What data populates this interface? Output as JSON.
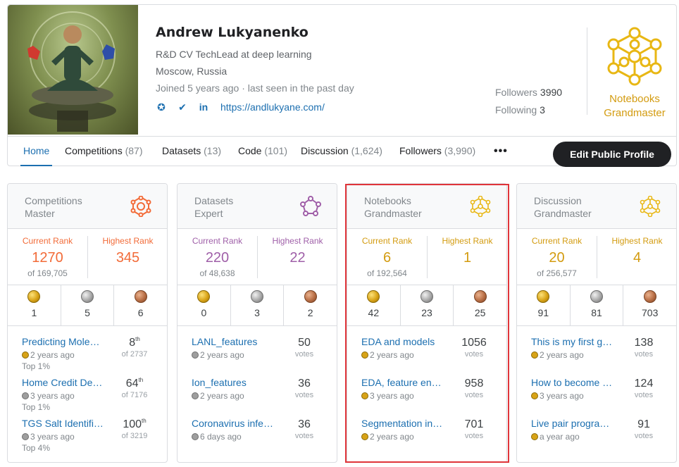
{
  "profile": {
    "name": "Andrew Lukyanenko",
    "occupation": "R&D CV TechLead at deep learning",
    "location": "Moscow, Russia",
    "joined": "Joined 5 years ago · last seen in the past day",
    "website": "https://andlukyane.com/",
    "social_icons": [
      "github-icon",
      "twitter-icon",
      "linkedin-icon"
    ],
    "social_glyphs": [
      "✪",
      "✔",
      "in"
    ],
    "followers_label": "Followers",
    "followers": "3990",
    "following_label": "Following",
    "following": "3",
    "tier": "Notebooks\nGrandmaster",
    "tier_line1": "Notebooks",
    "tier_line2": "Grandmaster"
  },
  "tabs": [
    {
      "label": "Home",
      "count": ""
    },
    {
      "label": "Competitions",
      "count": "(87)"
    },
    {
      "label": "Datasets",
      "count": "(13)"
    },
    {
      "label": "Code",
      "count": "(101)"
    },
    {
      "label": "Discussion",
      "count": "(1,624)"
    },
    {
      "label": "Followers",
      "count": "(3,990)"
    }
  ],
  "more_label": "•••",
  "edit_button": "Edit Public Profile",
  "colors": {
    "competitions": "#f26b38",
    "datasets": "#9f5fa8",
    "gold": "#d39b0f",
    "link": "#1c6fb0",
    "highlight": "#e0353a"
  },
  "cards": [
    {
      "title_line1": "Competitions",
      "title_line2": "Master",
      "current_rank_label": "Current Rank",
      "highest_rank_label": "Highest Rank",
      "current_rank": "1270",
      "of_total": "of 169,705",
      "highest_rank": "345",
      "medals": {
        "gold": "1",
        "silver": "5",
        "bronze": "6"
      },
      "items": [
        {
          "title": "Predicting Mole…",
          "medal": "gold",
          "age": "2 years ago",
          "sub": "Top 1%",
          "rank": "8",
          "suffix": "th",
          "unit": "of 2737"
        },
        {
          "title": "Home Credit De…",
          "medal": "silver",
          "age": "3 years ago",
          "sub": "Top 1%",
          "rank": "64",
          "suffix": "th",
          "unit": "of 7176"
        },
        {
          "title": "TGS Salt Identifi…",
          "medal": "silver",
          "age": "3 years ago",
          "sub": "Top 4%",
          "rank": "100",
          "suffix": "th",
          "unit": "of 3219"
        }
      ]
    },
    {
      "title_line1": "Datasets",
      "title_line2": "Expert",
      "current_rank_label": "Current Rank",
      "highest_rank_label": "Highest Rank",
      "current_rank": "220",
      "of_total": "of 48,638",
      "highest_rank": "22",
      "medals": {
        "gold": "0",
        "silver": "3",
        "bronze": "2"
      },
      "items": [
        {
          "title": "LANL_features",
          "medal": "silver",
          "age": "2 years ago",
          "sub": "",
          "rank": "50",
          "suffix": "",
          "unit": "votes"
        },
        {
          "title": "Ion_features",
          "medal": "silver",
          "age": "2 years ago",
          "sub": "",
          "rank": "36",
          "suffix": "",
          "unit": "votes"
        },
        {
          "title": "Coronavirus infe…",
          "medal": "silver",
          "age": "6 days ago",
          "sub": "",
          "rank": "36",
          "suffix": "",
          "unit": "votes"
        }
      ]
    },
    {
      "title_line1": "Notebooks",
      "title_line2": "Grandmaster",
      "current_rank_label": "Current Rank",
      "highest_rank_label": "Highest Rank",
      "current_rank": "6",
      "of_total": "of 192,564",
      "highest_rank": "1",
      "medals": {
        "gold": "42",
        "silver": "23",
        "bronze": "25"
      },
      "items": [
        {
          "title": "EDA and models",
          "medal": "gold",
          "age": "2 years ago",
          "sub": "",
          "rank": "1056",
          "suffix": "",
          "unit": "votes"
        },
        {
          "title": "EDA, feature en…",
          "medal": "gold",
          "age": "3 years ago",
          "sub": "",
          "rank": "958",
          "suffix": "",
          "unit": "votes"
        },
        {
          "title": "Segmentation in…",
          "medal": "gold",
          "age": "2 years ago",
          "sub": "",
          "rank": "701",
          "suffix": "",
          "unit": "votes"
        }
      ]
    },
    {
      "title_line1": "Discussion",
      "title_line2": "Grandmaster",
      "current_rank_label": "Current Rank",
      "highest_rank_label": "Highest Rank",
      "current_rank": "20",
      "of_total": "of 256,577",
      "highest_rank": "4",
      "medals": {
        "gold": "91",
        "silver": "81",
        "bronze": "703"
      },
      "items": [
        {
          "title": "This is my first g…",
          "medal": "gold",
          "age": "2 years ago",
          "sub": "",
          "rank": "138",
          "suffix": "",
          "unit": "votes"
        },
        {
          "title": "How to become …",
          "medal": "gold",
          "age": "3 years ago",
          "sub": "",
          "rank": "124",
          "suffix": "",
          "unit": "votes"
        },
        {
          "title": "Live pair progra…",
          "medal": "gold",
          "age": "a year ago",
          "sub": "",
          "rank": "91",
          "suffix": "",
          "unit": "votes"
        }
      ]
    }
  ]
}
